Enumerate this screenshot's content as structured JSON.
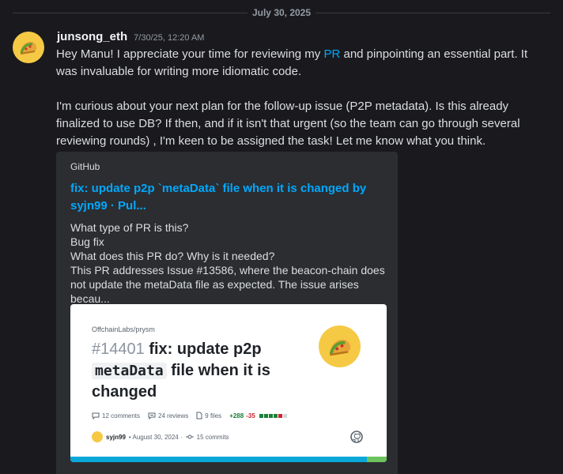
{
  "date_divider": "July 30, 2025",
  "author": {
    "username": "junsong_eth",
    "timestamp": "7/30/25, 12:20 AM",
    "avatar_icon": "taco-icon"
  },
  "message": {
    "p1_before": "Hey Manu! I appreciate your time for reviewing my ",
    "p1_link": "PR",
    "p1_after": " and pinpointing an essential part. It was invaluable for writing more idiomatic code.",
    "p2": "I'm curious about your next plan for the follow-up issue (P2P metadata). Is this already finalized to use DB? If then, and if it isn't that urgent (so the team can go through several reviewing rounds) , I'm keen to be assigned the task! Let me know what you think."
  },
  "embed": {
    "provider": "GitHub",
    "title": "fix: update p2p `metaData` file when it is changed by syjn99 · Pul...",
    "description_lines": [
      "What type of PR is this?",
      "Bug fix",
      "What does this PR do? Why is it needed?",
      "This PR addresses Issue #13586, where the beacon-chain does not update the metaData file as expected. The issue arises becau..."
    ],
    "card": {
      "repo": "OffchainLabs/prysm",
      "pr_number": "#14401",
      "title_part1": "fix: update p2p",
      "title_code": "metaData",
      "title_part2": "file when it is changed",
      "comments": "12 comments",
      "reviews": "24 reviews",
      "files": "9 files",
      "additions": "+288",
      "deletions": "-35",
      "author": "syjn99",
      "date": "• August 30, 2024 ·",
      "commits": "15 commits",
      "colors": {
        "add": "#1a7f37",
        "del": "#cf222e",
        "bar_main": "#09a8d8",
        "bar_end": "#6dc35d"
      }
    }
  },
  "colors": {
    "background": "#1a1a1e",
    "link": "#00a8fc",
    "embed_bg": "#2b2d31"
  }
}
